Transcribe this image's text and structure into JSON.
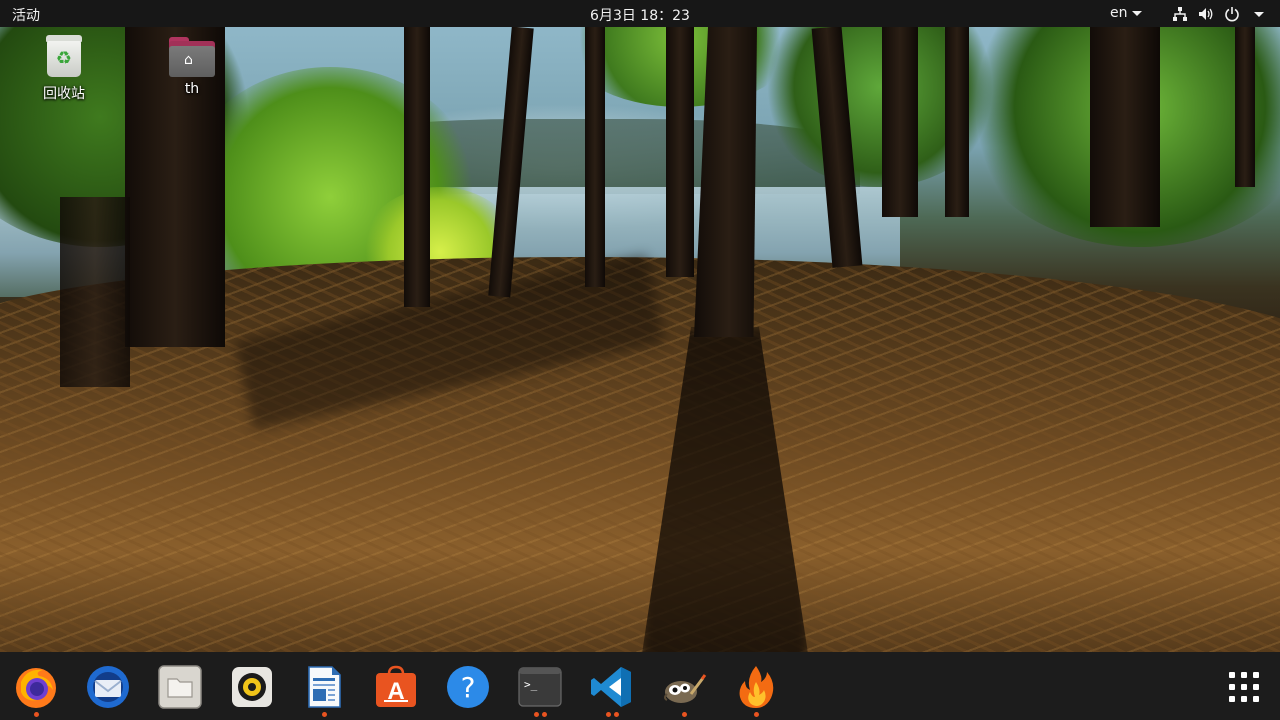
{
  "topbar": {
    "activities": "活动",
    "clock": "6月3日  18：23",
    "language": "en"
  },
  "desktop": {
    "icons": [
      {
        "label": "回收站",
        "icon": "trash-icon"
      },
      {
        "label": "th",
        "icon": "home-folder-icon"
      }
    ]
  },
  "dock": {
    "apps": [
      {
        "name": "Firefox",
        "icon": "firefox-icon",
        "running_dots": 1
      },
      {
        "name": "Thunderbird",
        "icon": "thunderbird-icon",
        "running_dots": 0
      },
      {
        "name": "Files",
        "icon": "files-icon",
        "running_dots": 0
      },
      {
        "name": "Rhythmbox",
        "icon": "rhythmbox-icon",
        "running_dots": 0
      },
      {
        "name": "LibreOffice Writer",
        "icon": "writer-icon",
        "running_dots": 1
      },
      {
        "name": "Ubuntu Software",
        "icon": "software-icon",
        "running_dots": 0
      },
      {
        "name": "Help",
        "icon": "help-icon",
        "running_dots": 0
      },
      {
        "name": "Terminal",
        "icon": "terminal-icon",
        "running_dots": 2
      },
      {
        "name": "Visual Studio Code",
        "icon": "vscode-icon",
        "running_dots": 2
      },
      {
        "name": "GIMP",
        "icon": "gimp-icon",
        "running_dots": 1
      },
      {
        "name": "Burner",
        "icon": "flame-icon",
        "running_dots": 1
      }
    ],
    "show_apps": "grid-icon"
  },
  "colors": {
    "topbar_bg": "#171717",
    "dock_bg": "#1c1c1c",
    "accent": "#e95420"
  }
}
